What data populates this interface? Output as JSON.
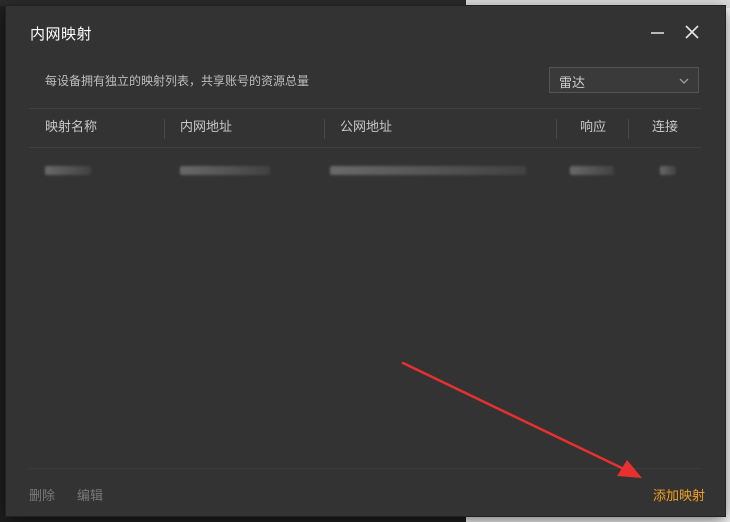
{
  "dialog": {
    "title": "内网映射",
    "description": "每设备拥有独立的映射列表，共享账号的资源总量",
    "select": {
      "value": "雷达"
    }
  },
  "table": {
    "columns": [
      "映射名称",
      "内网地址",
      "公网地址",
      "响应",
      "连接"
    ]
  },
  "footer": {
    "delete_label": "删除",
    "edit_label": "编辑",
    "add_label": "添加映射"
  },
  "colors": {
    "accent": "#f0a020",
    "annotation": "#e83030",
    "dialog_bg": "#333333"
  }
}
